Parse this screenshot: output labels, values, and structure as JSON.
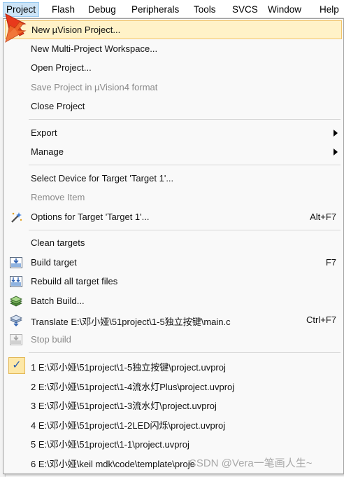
{
  "menubar": {
    "items": [
      {
        "label": "Project",
        "active": true
      },
      {
        "label": "Flash"
      },
      {
        "label": "Debug"
      },
      {
        "label": "Peripherals"
      },
      {
        "label": "Tools"
      },
      {
        "label": "SVCS"
      },
      {
        "label": "Window"
      },
      {
        "label": "Help"
      }
    ]
  },
  "menu": {
    "new_project": "New µVision Project...",
    "new_workspace": "New Multi-Project Workspace...",
    "open_project": "Open Project...",
    "save_project_v4": "Save Project in µVision4 format",
    "close_project": "Close Project",
    "export": "Export",
    "manage": "Manage",
    "select_device": "Select Device for Target 'Target 1'...",
    "remove_item": "Remove Item",
    "options_target": "Options for Target 'Target 1'...",
    "options_shortcut": "Alt+F7",
    "clean_targets": "Clean targets",
    "build_target": "Build target",
    "build_shortcut": "F7",
    "rebuild_all": "Rebuild all target files",
    "batch_build": "Batch Build...",
    "translate": "Translate E:\\邓小娅\\51project\\1-5独立按键\\main.c",
    "translate_shortcut": "Ctrl+F7",
    "stop_build": "Stop build",
    "recent": [
      "1 E:\\邓小娅\\51project\\1-5独立按键\\project.uvproj",
      "2 E:\\邓小娅\\51project\\1-4流水灯Plus\\project.uvproj",
      "3 E:\\邓小娅\\51project\\1-3流水灯\\project.uvproj",
      "4 E:\\邓小娅\\51project\\1-2LED闪烁\\project.uvproj",
      "5 E:\\邓小娅\\51project\\1-1\\project.uvproj",
      "6 E:\\邓小娅\\keil mdk\\code\\template\\proje"
    ]
  },
  "watermark": "CSDN @Vera一笔画人生~",
  "colors": {
    "highlight": "#fff2c8",
    "highlight_border": "#f2c46a",
    "disabled_text": "#8a8a8a",
    "pointer": "#e8391b"
  }
}
